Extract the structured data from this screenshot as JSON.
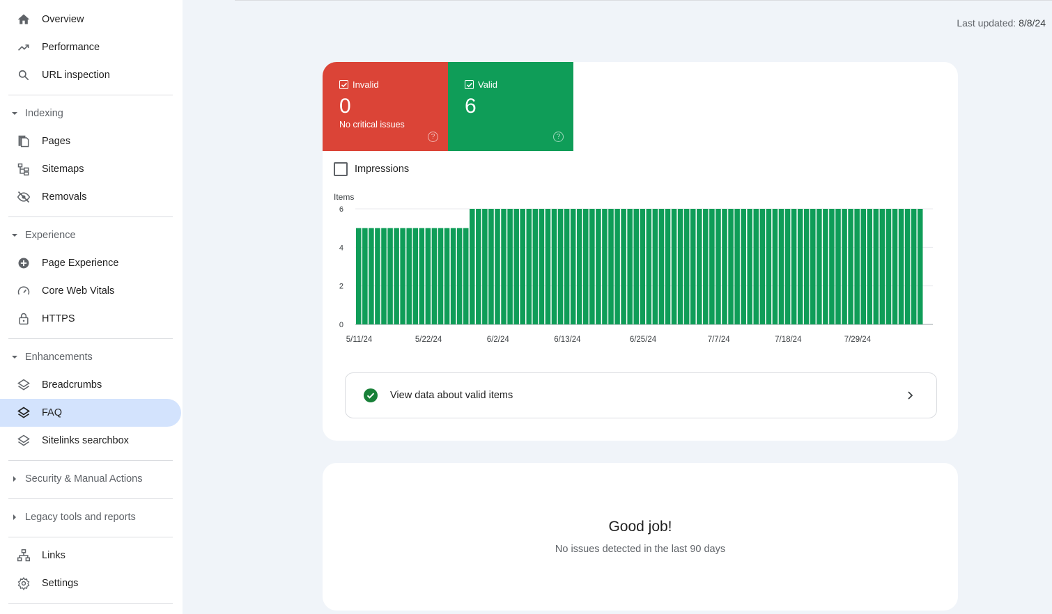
{
  "sidebar": {
    "top": [
      {
        "label": "Overview",
        "icon": "home-icon"
      },
      {
        "label": "Performance",
        "icon": "trending-up-icon"
      },
      {
        "label": "URL inspection",
        "icon": "search-icon"
      }
    ],
    "sections": [
      {
        "label": "Indexing",
        "expanded": true,
        "items": [
          {
            "label": "Pages",
            "icon": "pages-icon"
          },
          {
            "label": "Sitemaps",
            "icon": "sitemap-icon"
          },
          {
            "label": "Removals",
            "icon": "eye-off-icon"
          }
        ]
      },
      {
        "label": "Experience",
        "expanded": true,
        "items": [
          {
            "label": "Page Experience",
            "icon": "plus-circle-icon"
          },
          {
            "label": "Core Web Vitals",
            "icon": "speedometer-icon"
          },
          {
            "label": "HTTPS",
            "icon": "lock-icon"
          }
        ]
      },
      {
        "label": "Enhancements",
        "expanded": true,
        "items": [
          {
            "label": "Breadcrumbs",
            "icon": "layers-icon"
          },
          {
            "label": "FAQ",
            "icon": "layers-icon",
            "active": true
          },
          {
            "label": "Sitelinks searchbox",
            "icon": "layers-icon"
          }
        ]
      },
      {
        "label": "Security & Manual Actions",
        "expanded": false
      },
      {
        "label": "Legacy tools and reports",
        "expanded": false
      }
    ],
    "bottom": [
      {
        "label": "Links",
        "icon": "links-icon"
      },
      {
        "label": "Settings",
        "icon": "gear-icon"
      }
    ]
  },
  "header": {
    "last_updated_label": "Last updated:",
    "last_updated_value": "8/8/24"
  },
  "summary": {
    "invalid": {
      "label": "Invalid",
      "count": "0",
      "sub": "No critical issues",
      "color": "#db4437"
    },
    "valid": {
      "label": "Valid",
      "count": "6",
      "color": "#0f9d58"
    }
  },
  "impressions_label": "Impressions",
  "chart_data": {
    "type": "bar",
    "ylabel": "Items",
    "ylim": [
      0,
      6
    ],
    "yticks": [
      0,
      2,
      4,
      6
    ],
    "color": "#0f9d58",
    "x_tick_labels": [
      "5/11/24",
      "5/22/24",
      "6/2/24",
      "6/13/24",
      "6/25/24",
      "7/7/24",
      "7/18/24",
      "7/29/24"
    ],
    "x_tick_indices": [
      0,
      11,
      22,
      33,
      45,
      57,
      68,
      79
    ],
    "series": [
      {
        "values": [
          5,
          5,
          5,
          5,
          5,
          5,
          5,
          5,
          5,
          5,
          5,
          5,
          5,
          5,
          5,
          5,
          5,
          5,
          6,
          6,
          6,
          6,
          6,
          6,
          6,
          6,
          6,
          6,
          6,
          6,
          6,
          6,
          6,
          6,
          6,
          6,
          6,
          6,
          6,
          6,
          6,
          6,
          6,
          6,
          6,
          6,
          6,
          6,
          6,
          6,
          6,
          6,
          6,
          6,
          6,
          6,
          6,
          6,
          6,
          6,
          6,
          6,
          6,
          6,
          6,
          6,
          6,
          6,
          6,
          6,
          6,
          6,
          6,
          6,
          6,
          6,
          6,
          6,
          6,
          6,
          6,
          6,
          6,
          6,
          6,
          6,
          6,
          6,
          6,
          6
        ]
      }
    ]
  },
  "view_button_label": "View data about valid items",
  "status_card": {
    "title": "Good job!",
    "desc": "No issues detected in the last 90 days"
  }
}
